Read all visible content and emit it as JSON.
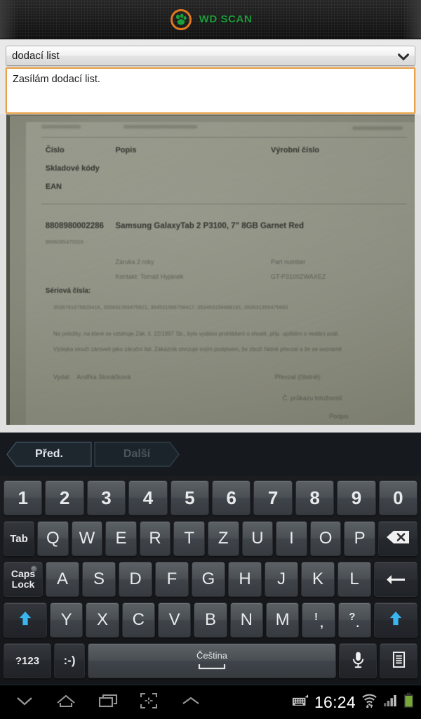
{
  "app": {
    "logo_text": "WD SCAN",
    "logo_icon": "paw-in-ring-logo",
    "accent_orange": "#e07820",
    "accent_green": "#1f9c3c"
  },
  "form": {
    "doc_type_select": {
      "value": "dodací list",
      "icon": "chevron-down-icon"
    },
    "note_field": {
      "value": "Zasílám dodací list.",
      "placeholder": "",
      "focus_color": "#e8a24a"
    }
  },
  "preview": {
    "alt": "scanned-delivery-note-photo",
    "document": {
      "col_headers": [
        "Číslo",
        "Popis",
        "Výrobní číslo"
      ],
      "row_labels": [
        "Skladové kódy",
        "EAN"
      ],
      "item_code": "8808980002286",
      "item_code_sub": "8806085470026",
      "item_desc": "Samsung GalaxyTab 2 P3100, 7\" 8GB Garnet Red",
      "warranty": "Záruka 2 roky",
      "contact": "Kontakt: Tomáš Hyjánek",
      "part_number_label": "Part number",
      "part_number": "GT-P3100ZWAXEZ",
      "serial_label": "Sériová čísla:",
      "serials": "353876187582941K,   355631356475621,   354531566758417,   353453156688191,   350631355475683",
      "legal_line_1": "Na položky, na které se vztahuje Zák. č. 22/1997 Sb., bylo vydáno prohlášení o shodě, příp. upištění o nedání podl.",
      "legal_line_2": "Výdejka slouží zároveň jako záruční list. Zákazník stvrzuje svým podpisem, že zboží řádně převzal a že se seznámil",
      "issued_by_label": "Vydal:",
      "issued_by": "Andřka Slováčková",
      "received_label": "Převzal (čitelně):",
      "id_label": "Č. průkazu totožnosti",
      "signature_label": "Podpis"
    }
  },
  "pager": {
    "prev_label": "Před.",
    "prev_enabled": true,
    "next_label": "Další",
    "next_enabled": false
  },
  "keyboard": {
    "language": "Čeština",
    "rows": {
      "numbers": [
        "1",
        "2",
        "3",
        "4",
        "5",
        "6",
        "7",
        "8",
        "9",
        "0"
      ],
      "top": [
        "Q",
        "W",
        "E",
        "R",
        "T",
        "Z",
        "U",
        "I",
        "O",
        "P"
      ],
      "home": [
        "A",
        "S",
        "D",
        "F",
        "G",
        "H",
        "J",
        "K",
        "L"
      ],
      "bottom": [
        "Y",
        "X",
        "C",
        "V",
        "B",
        "N",
        "M"
      ]
    },
    "keys": {
      "tab": "Tab",
      "backspace_icon": "backspace-icon",
      "caps_lock": "Caps\nLock",
      "caps_line1": "Caps",
      "caps_line2": "Lock",
      "enter_icon": "enter-icon",
      "shift_icon": "shift-arrow-icon",
      "punct_1_top": "!",
      "punct_1_bottom": ",",
      "punct_2_top": "?",
      "punct_2_bottom": ".",
      "symbols": "?123",
      "emoji": ":-)",
      "mic_icon": "microphone-icon",
      "clipboard_icon": "clipboard-icon"
    }
  },
  "system_bar": {
    "hide_keyboard_icon": "chevron-down-icon",
    "home_icon": "home-icon",
    "recents_icon": "recents-icon",
    "screenshot_icon": "screenshot-crop-icon",
    "expand_icon": "chevron-up-icon",
    "keyboard_status_icon": "keyboard-icon",
    "clock": "16:24",
    "wifi_icon": "wifi-transfer-icon",
    "signal_icon": "signal-bars-icon",
    "battery_icon": "battery-full-icon",
    "battery_color": "#8dc63f"
  }
}
